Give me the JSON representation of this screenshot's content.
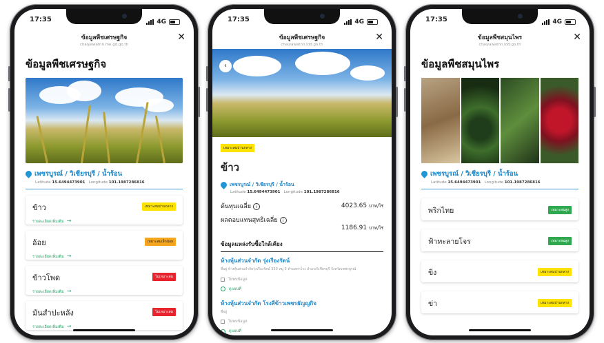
{
  "status": {
    "time": "17:35",
    "network": "4G"
  },
  "phone1": {
    "nav_title": "ข้อมูลพืชเศรษฐกิจ",
    "nav_subtitle": "chaiyawatnn.me.gd.go.th",
    "heading": "ข้อมูลพืชเศรษฐกิจ",
    "location": "เพชรบูรณ์ / วิเชียรบุรี / น้ำร้อน",
    "lat_label": "Latitude",
    "lat": "15.6494473901",
    "lng_label": "Longitude",
    "lng": "101.1987286816",
    "crops": [
      {
        "name": "ข้าว",
        "link": "รายละเอียดเพิ่มเติม",
        "badge": "เหมาะสมปานกลาง",
        "badge_color": "#ffe300"
      },
      {
        "name": "อ้อย",
        "link": "รายละเอียดเพิ่มเติม",
        "badge": "เหมาะสมเล็กน้อย",
        "badge_color": "#f5a51e"
      },
      {
        "name": "ข้าวโพด",
        "link": "รายละเอียดเพิ่มเติม",
        "badge": "ไม่เหมาะสม",
        "badge_color": "#e8232d"
      },
      {
        "name": "มันสำปะหลัง",
        "link": "รายละเอียดเพิ่มเติม",
        "badge": "ไม่เหมาะสม",
        "badge_color": "#e8232d"
      }
    ]
  },
  "phone2": {
    "nav_title": "ข้อมูลพืชเศรษฐกิจ",
    "nav_subtitle": "chaiyawatnn.ldd.go.th",
    "tag": "เหมาะสมปานกลาง",
    "title": "ข้าว",
    "location": "เพชรบูรณ์ / วิเชียรบุรี / น้ำร้อน",
    "lat_label": "Latitude",
    "lat": "15.6494473901",
    "lng_label": "Longitude",
    "lng": "101.1987286816",
    "cost_label": "ต้นทุนเฉลี่ย",
    "cost_value": "4023.65",
    "cost_unit": "บาท/ไร่",
    "return_label": "ผลตอบแทนสุทธิเฉลี่ย",
    "return_value": "1186.91",
    "return_unit": "บาท/ไร่",
    "section": "ข้อมูลแหล่งรับซื้อใกล้เคียง",
    "shops": [
      {
        "name": "ห้างหุ้นส่วนจำกัด รุ่งเรืองรัตน์",
        "desc": "ที่อยู่ ห้างหุ้นส่วนจำกัดรุ่งเรืองรัตน์ 350 หมู่ 5 ตำบลท่าโรง อำเภอวิเชียรบุรี จังหวัดเพชรบูรณ์",
        "phone": "ไม่พบข้อมูล",
        "map": "ดูแผนที่"
      },
      {
        "name": "ห้างหุ้นส่วนจำกัด โรงสีข้าวเพชรธัญญกิจ",
        "desc": "ที่อยู่",
        "phone": "ไม่พบข้อมูล",
        "map": "ดูแผนที่"
      }
    ]
  },
  "phone3": {
    "nav_title": "ข้อมูลพืชสมุนไพร",
    "nav_subtitle": "chaiyawatnn.ldd.go.th",
    "heading": "ข้อมูลพืชสมุนไพร",
    "location": "เพชรบูรณ์ / วิเชียรบุรี / น้ำร้อน",
    "lat_label": "Latitude",
    "lat": "15.6494473901",
    "lng_label": "Longitude",
    "lng": "101.1987286816",
    "herbs": [
      {
        "name": "พริกไทย",
        "badge": "เหมาะสมสูง",
        "badge_color": "#2fa84f"
      },
      {
        "name": "ฟ้าทะลายโจร",
        "badge": "เหมาะสมสูง",
        "badge_color": "#2fa84f"
      },
      {
        "name": "ขิง",
        "badge": "เหมาะสมปานกลาง",
        "badge_color": "#ffe300"
      },
      {
        "name": "ข่า",
        "badge": "เหมาะสมปานกลาง",
        "badge_color": "#ffe300"
      }
    ]
  }
}
